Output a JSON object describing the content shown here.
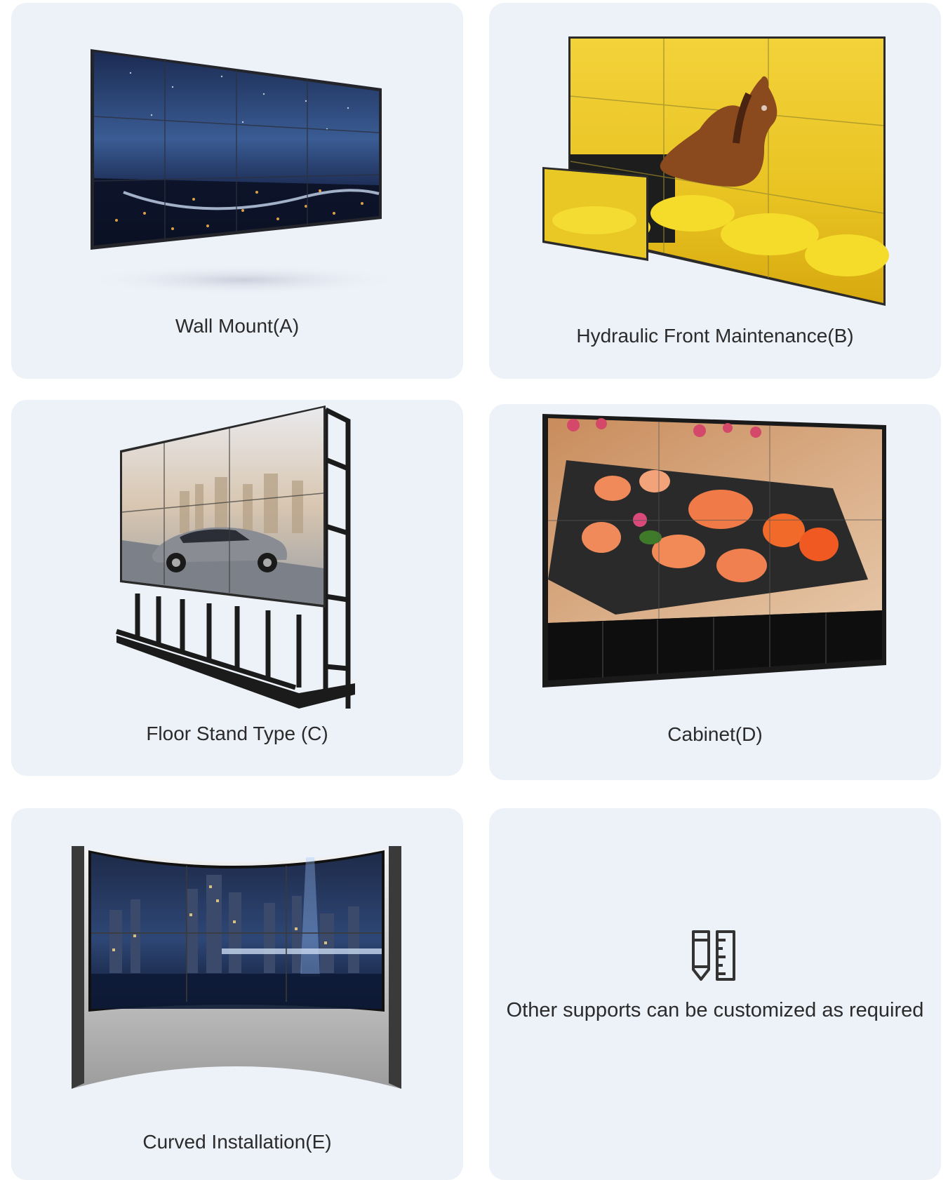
{
  "cards": [
    {
      "caption": "Wall Mount(A)",
      "image": "video-wall-night-city-skyline"
    },
    {
      "caption": "Hydraulic Front Maintenance(B)",
      "image": "video-wall-horse-yellow-flowers"
    },
    {
      "caption": "Floor Stand Type (C)",
      "image": "video-wall-car-floor-stand"
    },
    {
      "caption": "Cabinet(D)",
      "image": "video-wall-sushi-cabinet"
    },
    {
      "caption": "Curved Installation(E)",
      "image": "curved-video-wall-city-night"
    }
  ],
  "custom_note": {
    "text": "Other supports can be customized as required",
    "icon": "pencil-ruler-icon"
  },
  "colors": {
    "card_background": "#edf1f8",
    "text": "#2b2b2b"
  }
}
